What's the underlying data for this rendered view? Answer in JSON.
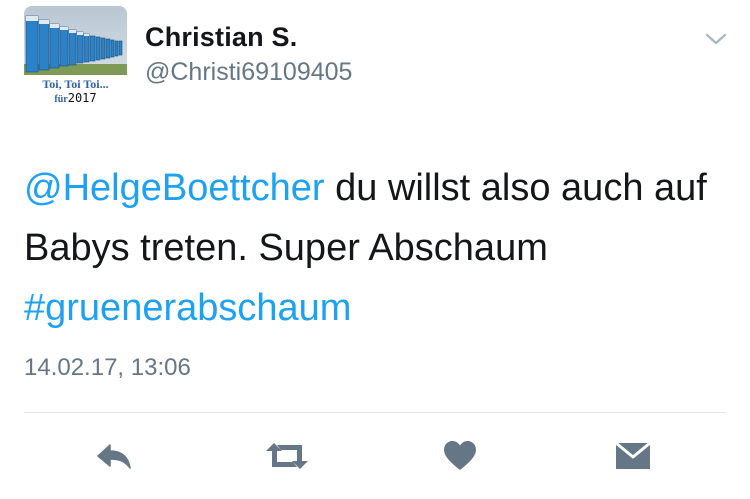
{
  "profile": {
    "display_name": "Christian S.",
    "handle": "@Christi69109405",
    "avatar": {
      "caption_line1": "Toi, Toi Toi...",
      "caption_line2_prefix": "für",
      "caption_year": "2017"
    }
  },
  "tweet": {
    "mention": "@HelgeBoettcher",
    "text_middle": " du willst also auch auf Babys treten. Super Abschaum ",
    "hashtag": "#gruenerabschaum",
    "timestamp": "14.02.17, 13:06"
  },
  "actions": {
    "reply_icon": "reply-icon",
    "retweet_icon": "retweet-icon",
    "like_icon": "heart-icon",
    "dm_icon": "envelope-icon"
  },
  "colors": {
    "link": "#1da1f2",
    "text": "#14171a",
    "secondary": "#657786",
    "icon": "#657786",
    "divider": "#e1e8ed"
  }
}
